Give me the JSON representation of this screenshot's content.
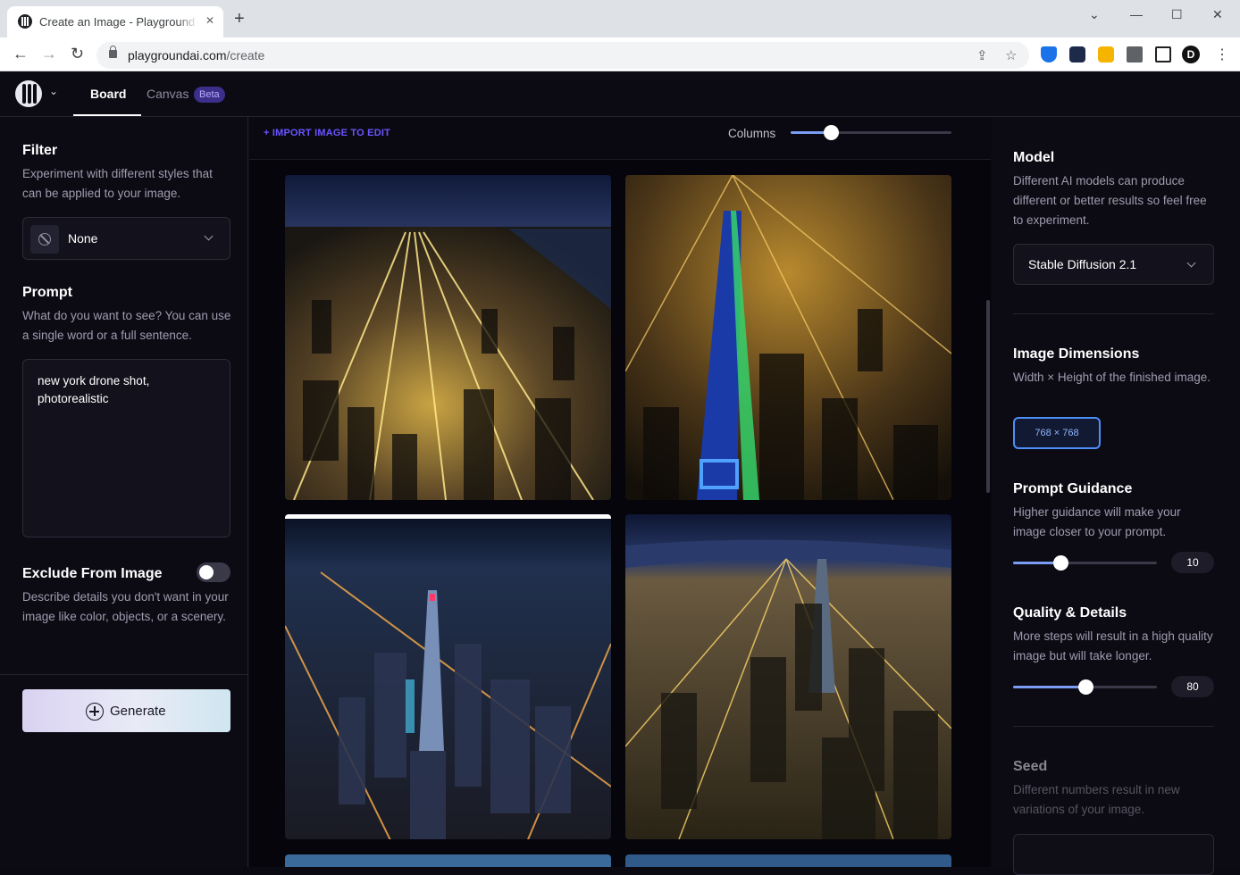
{
  "browser": {
    "tab_title": "Create an Image - Playground AI",
    "close_glyph": "✕",
    "new_tab_glyph": "+",
    "window_controls": {
      "minimize": "—",
      "maximize": "☐",
      "close": "✕",
      "dropdown": "⌄"
    },
    "nav": {
      "back": "←",
      "forward": "→",
      "reload": "↻"
    },
    "url_host": "playgroundai.com",
    "url_path": "/create",
    "profile_initial": "D",
    "kebab": "⋮",
    "extension_colors": [
      "#1a73e8",
      "#1e2a4a",
      "#f4b400",
      "#5f6368",
      "#202124"
    ]
  },
  "app": {
    "tabs": {
      "board": "Board",
      "canvas": "Canvas",
      "canvas_badge": "Beta"
    },
    "logo_chevron": "⌄"
  },
  "left": {
    "filter": {
      "title": "Filter",
      "desc": "Experiment with different styles that can be applied to your image.",
      "value": "None"
    },
    "prompt": {
      "title": "Prompt",
      "desc": "What do you want to see? You can use a single word or a full sentence.",
      "value": "new york drone shot,\nphotorealistic"
    },
    "exclude": {
      "title": "Exclude From Image",
      "toggle_on": false,
      "desc": "Describe details you don't want in your image like color, objects, or a scenery."
    },
    "generate_label": "Generate"
  },
  "center": {
    "import_label": "+ IMPORT IMAGE TO EDIT",
    "columns_label": "Columns",
    "columns_value": 0.25
  },
  "right": {
    "model": {
      "title": "Model",
      "desc": "Different AI models can produce different or better results so feel free to experiment.",
      "value": "Stable Diffusion 2.1"
    },
    "dimensions": {
      "title": "Image Dimensions",
      "desc": "Width × Height of the finished image.",
      "value": "768 × 768"
    },
    "guidance": {
      "title": "Prompt Guidance",
      "desc": "Higher guidance will make your image closer to your prompt.",
      "value": "10",
      "fraction": 0.33
    },
    "quality": {
      "title": "Quality & Details",
      "desc": "More steps will result in a high quality image but will take longer.",
      "value": "80",
      "fraction": 0.5
    },
    "seed": {
      "title": "Seed",
      "desc": "Different numbers result in new variations of your image."
    }
  }
}
